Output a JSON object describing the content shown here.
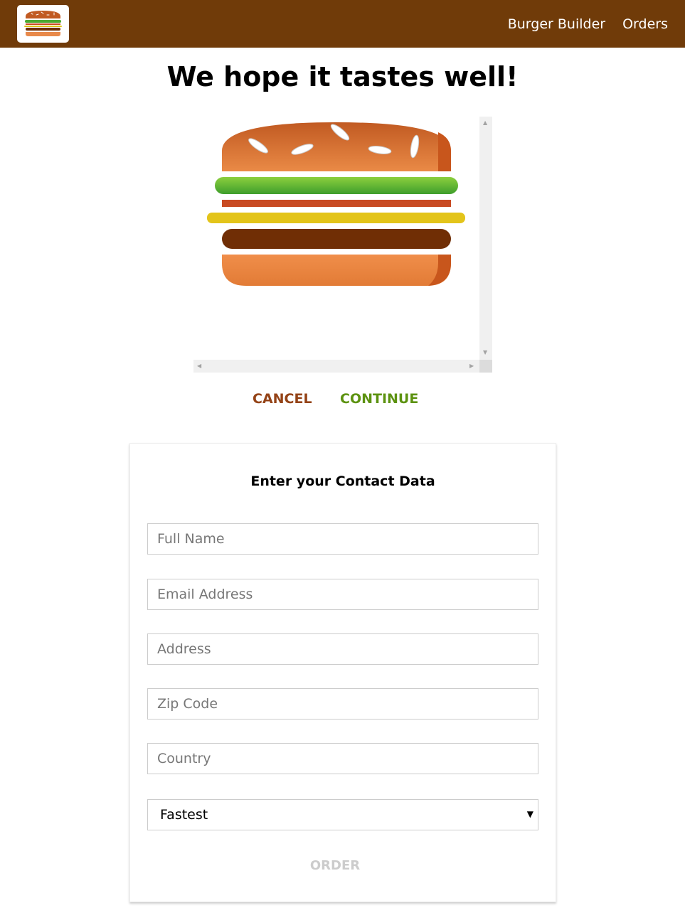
{
  "header": {
    "logo_alt": "Burger logo",
    "nav": [
      {
        "label": "Burger Builder"
      },
      {
        "label": "Orders"
      }
    ]
  },
  "summary": {
    "headline": "We hope it tastes well!",
    "ingredients": [
      "bread-top",
      "salad",
      "bacon",
      "cheese",
      "meat",
      "bread-bottom"
    ],
    "cancel_label": "CANCEL",
    "continue_label": "CONTINUE"
  },
  "contact_form": {
    "title": "Enter your Contact Data",
    "fields": [
      {
        "placeholder": "Full Name",
        "value": ""
      },
      {
        "placeholder": "Email Address",
        "value": ""
      },
      {
        "placeholder": "Address",
        "value": ""
      },
      {
        "placeholder": "Zip Code",
        "value": ""
      },
      {
        "placeholder": "Country",
        "value": ""
      }
    ],
    "delivery_method": "Fastest",
    "order_label": "ORDER"
  },
  "colors": {
    "toolbar": "#703b09",
    "cancel": "#944317",
    "continue": "#5c9210",
    "order_disabled": "#cccccc"
  }
}
